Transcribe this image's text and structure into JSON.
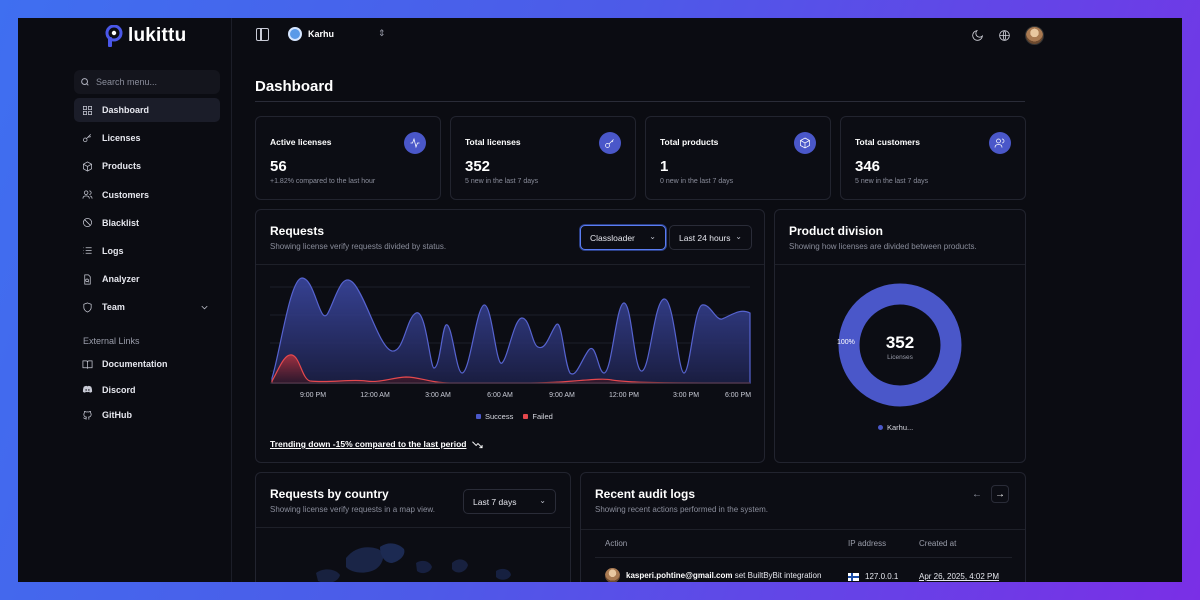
{
  "app": {
    "name": "lukittu"
  },
  "sidebar": {
    "search_placeholder": "Search menu...",
    "items": [
      {
        "label": "Dashboard",
        "icon": "grid-icon",
        "active": true
      },
      {
        "label": "Licenses",
        "icon": "key-icon"
      },
      {
        "label": "Products",
        "icon": "box-icon"
      },
      {
        "label": "Customers",
        "icon": "users-icon"
      },
      {
        "label": "Blacklist",
        "icon": "ban-icon"
      },
      {
        "label": "Logs",
        "icon": "list-icon"
      },
      {
        "label": "Analyzer",
        "icon": "file-search-icon"
      },
      {
        "label": "Team",
        "icon": "shield-icon",
        "expandable": true
      }
    ],
    "external_label": "External Links",
    "external": [
      {
        "label": "Documentation",
        "icon": "book-icon"
      },
      {
        "label": "Discord",
        "icon": "discord-icon"
      },
      {
        "label": "GitHub",
        "icon": "github-icon"
      }
    ]
  },
  "topbar": {
    "team_name": "Karhu"
  },
  "page": {
    "title": "Dashboard"
  },
  "stats": [
    {
      "label": "Active licenses",
      "value": "56",
      "sub": "+1.82% compared to the last hour",
      "icon": "activity-icon"
    },
    {
      "label": "Total licenses",
      "value": "352",
      "sub": "5 new in the last 7 days",
      "icon": "key-icon"
    },
    {
      "label": "Total products",
      "value": "1",
      "sub": "0 new in the last 7 days",
      "icon": "box-icon"
    },
    {
      "label": "Total customers",
      "value": "346",
      "sub": "5 new in the last 7 days",
      "icon": "users-icon"
    }
  ],
  "requests": {
    "title": "Requests",
    "subtitle": "Showing license verify requests divided by status.",
    "filter_product": "Classloader",
    "filter_range": "Last 24 hours",
    "x_labels": [
      "9:00 PM",
      "12:00 AM",
      "3:00 AM",
      "6:00 AM",
      "9:00 AM",
      "12:00 PM",
      "3:00 PM",
      "6:00 PM"
    ],
    "legend": [
      {
        "label": "Success",
        "color": "#4a57c9"
      },
      {
        "label": "Failed",
        "color": "#e5484d"
      }
    ],
    "trend": "Trending down -15% compared to the last period"
  },
  "product_division": {
    "title": "Product division",
    "subtitle": "Showing how licenses are divided between products.",
    "total": "352",
    "total_label": "Licenses",
    "slice_label": "100%",
    "legend": "Karhu...",
    "color": "#4a57c9"
  },
  "country": {
    "title": "Requests by country",
    "subtitle": "Showing license verify requests in a map view.",
    "range": "Last 7 days"
  },
  "audit": {
    "title": "Recent audit logs",
    "subtitle": "Showing recent actions performed in the system.",
    "columns": [
      "Action",
      "IP address",
      "Created at"
    ],
    "rows": [
      {
        "user": "kasperi.pohtine@gmail.com",
        "action": "set BuiltByBit integration",
        "ip": "127.0.0.1",
        "created": "Apr 26, 2025, 4:02 PM"
      }
    ]
  },
  "chart_data": {
    "type": "area",
    "x": [
      "9:00 PM",
      "12:00 AM",
      "3:00 AM",
      "6:00 AM",
      "9:00 AM",
      "12:00 PM",
      "3:00 PM",
      "6:00 PM"
    ],
    "series": [
      {
        "name": "Success",
        "color": "#4a57c9"
      },
      {
        "name": "Failed",
        "color": "#e5484d"
      }
    ],
    "grid": true,
    "legend": "bottom"
  }
}
